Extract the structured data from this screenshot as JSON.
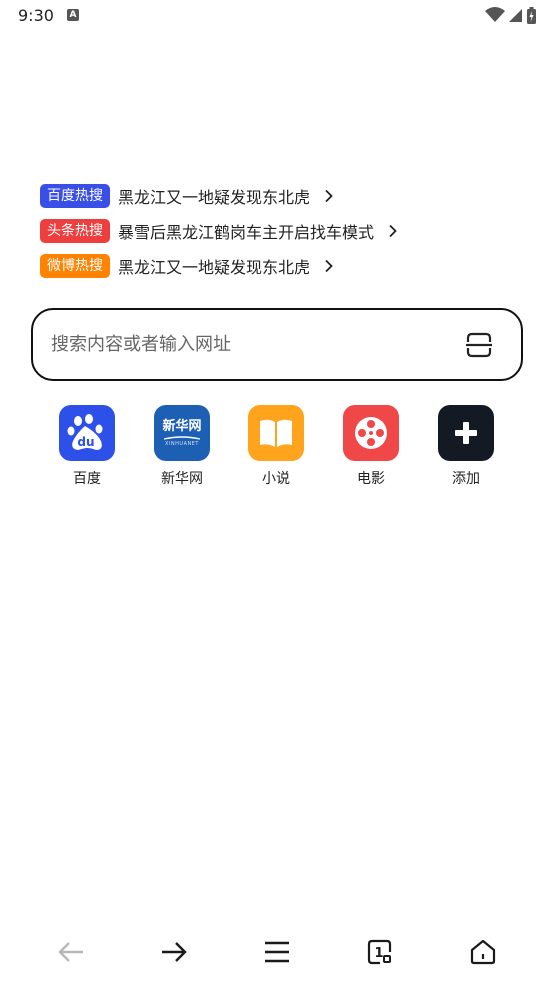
{
  "status_bar": {
    "time": "9:30",
    "notification_icon": "A"
  },
  "hot_searches": [
    {
      "badge": "百度热搜",
      "badge_color": "#3a4fe8",
      "title": "黑龙江又一地疑发现东北虎"
    },
    {
      "badge": "头条热搜",
      "badge_color": "#ee3e3e",
      "title": "暴雪后黑龙江鹤岗车主开启找车模式"
    },
    {
      "badge": "微博热搜",
      "badge_color": "#ff8200",
      "title": "黑龙江又一地疑发现东北虎"
    }
  ],
  "search": {
    "placeholder": "搜索内容或者输入网址",
    "value": ""
  },
  "shortcuts": [
    {
      "label": "百度",
      "icon": "baidu-paw-icon",
      "color": "#2d50e8"
    },
    {
      "label": "新华网",
      "icon": "xinhua-logo-icon",
      "logo_text": "新华网",
      "logo_sub": "XINHUANET",
      "color": "#1d5fb3"
    },
    {
      "label": "小说",
      "icon": "book-icon",
      "color": "#ffa41c"
    },
    {
      "label": "电影",
      "icon": "film-reel-icon",
      "color": "#f04848"
    },
    {
      "label": "添加",
      "icon": "plus-icon",
      "color": "#141a24"
    }
  ],
  "bottom_nav": {
    "tab_count": "1"
  }
}
